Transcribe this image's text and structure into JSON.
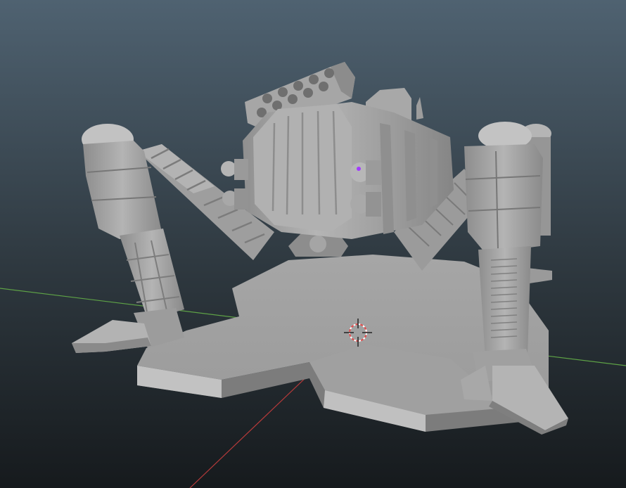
{
  "viewport": {
    "background_top": "#4f6271",
    "background_bottom": "#161a1d",
    "axis_x_color": "#b63a3a",
    "axis_y_color": "#5ea246",
    "model_color": "#a9a9a9",
    "model_shadow": "#6e6e6e",
    "model_highlight": "#c9c9c9",
    "selected_vertex_color": "#a23cff",
    "cursor_colors": [
      "#e14b4b",
      "#ffffff",
      "#222222"
    ]
  },
  "scene": {
    "object": "mech-walker-model",
    "pivot": "3d-cursor-icon"
  }
}
